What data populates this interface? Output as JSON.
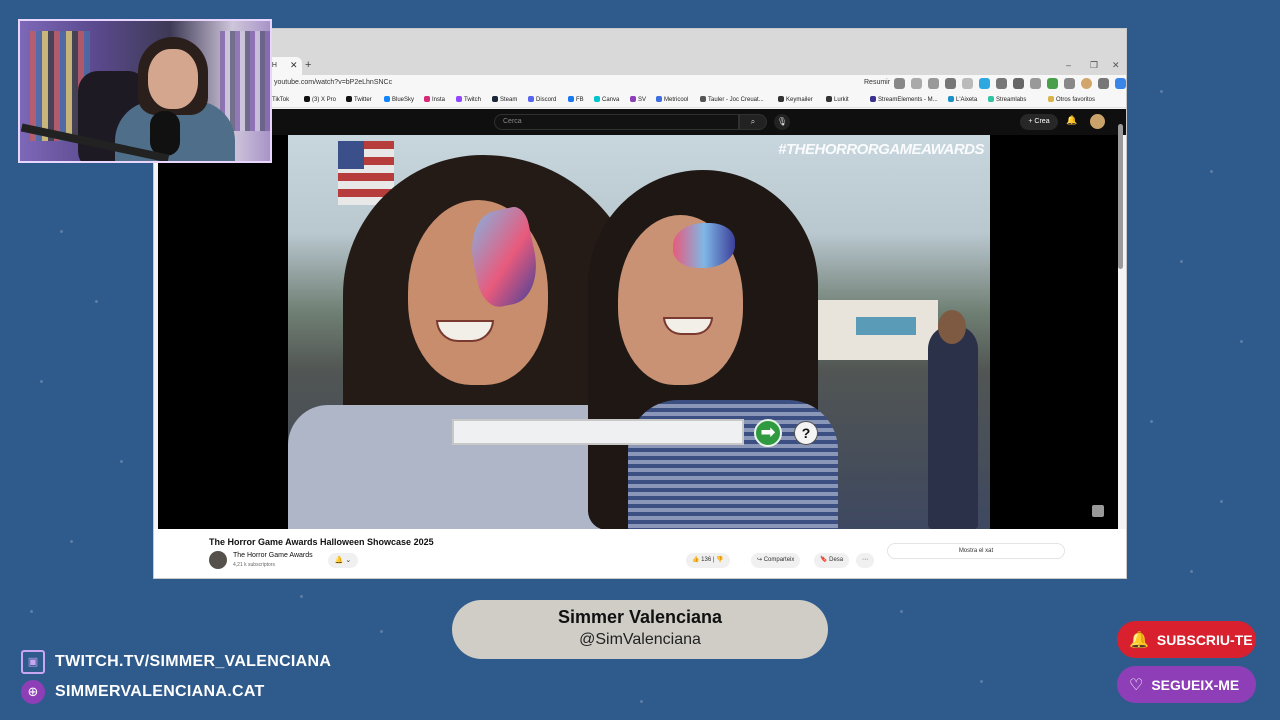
{
  "browser": {
    "tab_title": "h H",
    "url": "youtube.com/watch?v=bP2eLhnSNCc",
    "resumir_label": "Resumir",
    "bookmarks": [
      {
        "label": "TikTok",
        "color": "#111111"
      },
      {
        "label": "(3) X Pro",
        "color": "#111111"
      },
      {
        "label": "Twitter",
        "color": "#111111"
      },
      {
        "label": "BlueSky",
        "color": "#1185fe"
      },
      {
        "label": "Insta",
        "color": "#d62976"
      },
      {
        "label": "Twitch",
        "color": "#9146ff"
      },
      {
        "label": "Steam",
        "color": "#1b2838"
      },
      {
        "label": "Discord",
        "color": "#5865f2"
      },
      {
        "label": "FB",
        "color": "#1877f2"
      },
      {
        "label": "Canva",
        "color": "#00c4cc"
      },
      {
        "label": "SV",
        "color": "#8e3fb8"
      },
      {
        "label": "Metricool",
        "color": "#3c6ee0"
      },
      {
        "label": "Tauler - Joc Creuat...",
        "color": "#555555"
      },
      {
        "label": "Keymailer",
        "color": "#333333"
      },
      {
        "label": "Lurkit",
        "color": "#333333"
      },
      {
        "label": "StreamElements - M...",
        "color": "#3b2f8f"
      },
      {
        "label": "L'Aixeta",
        "color": "#1e90c8"
      },
      {
        "label": "Streamlabs",
        "color": "#31c3a2"
      }
    ],
    "other_favorites": "Otros favoritos"
  },
  "youtube": {
    "search_placeholder": "Cerca",
    "create_label": "Crea",
    "video_title": "The Horror Game Awards Halloween Showcase 2025",
    "channel_name": "The Horror Game Awards",
    "subscribers": "4,21 k subscriptors",
    "likes": "136",
    "share_label": "Comparteix",
    "save_label": "Desa",
    "chat_label": "Mostra el xat",
    "video_overlay_hashtag": "#THEHORRORGAMEAWARDS"
  },
  "overlay": {
    "streamer_name": "Simmer Valenciana",
    "streamer_handle": "@SimValenciana",
    "twitch_link": "TWITCH.TV/SIMMER_VALENCIANA",
    "website_link": "SIMMERVALENCIANA.CAT",
    "subscribe_label": "SUBSCRIU-TE",
    "follow_label": "SEGUEIX-ME",
    "colors": {
      "background": "#2f5a8c",
      "subscribe": "#d9202f",
      "follow": "#8e3fb8",
      "nameplate": "#cfcdc6"
    }
  }
}
